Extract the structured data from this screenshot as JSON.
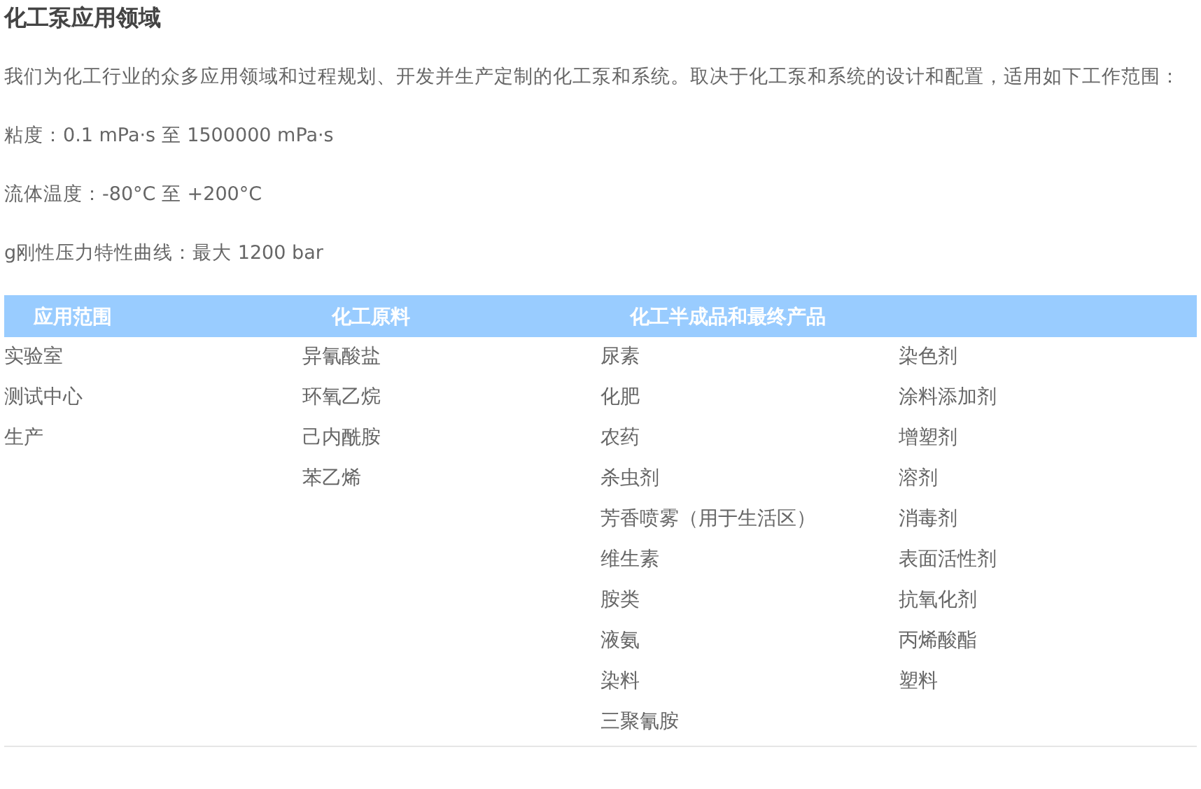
{
  "title": "化工泵应用领域",
  "paragraphs": [
    "我们为化工行业的众多应用领域和过程规划、开发并生产定制的化工泵和系统。取决于化工泵和系统的设计和配置，适用如下工作范围：",
    "粘度：0.1 mPa·s 至 1500000 mPa·s",
    "流体温度：-80°C 至 +200°C",
    "g刚性压力特性曲线：最大 1200 bar"
  ],
  "table": {
    "headers": [
      {
        "label": "应用范围"
      },
      {
        "label": "化工原料"
      },
      {
        "label": "化工半成品和最终产品"
      }
    ],
    "columns": [
      [
        "实验室",
        "测试中心",
        "生产"
      ],
      [
        "异氰酸盐",
        "环氧乙烷",
        "己内酰胺",
        "苯乙烯"
      ],
      [
        "尿素",
        "化肥",
        "农药",
        "杀虫剂",
        "芳香喷雾（用于生活区）",
        "维生素",
        "胺类",
        "液氨",
        "染料",
        "三聚氰胺"
      ],
      [
        "染色剂",
        "涂料添加剂",
        "增塑剂",
        "溶剂",
        "消毒剂",
        "表面活性剂",
        "抗氧化剂",
        "丙烯酸酯",
        "塑料"
      ]
    ]
  }
}
